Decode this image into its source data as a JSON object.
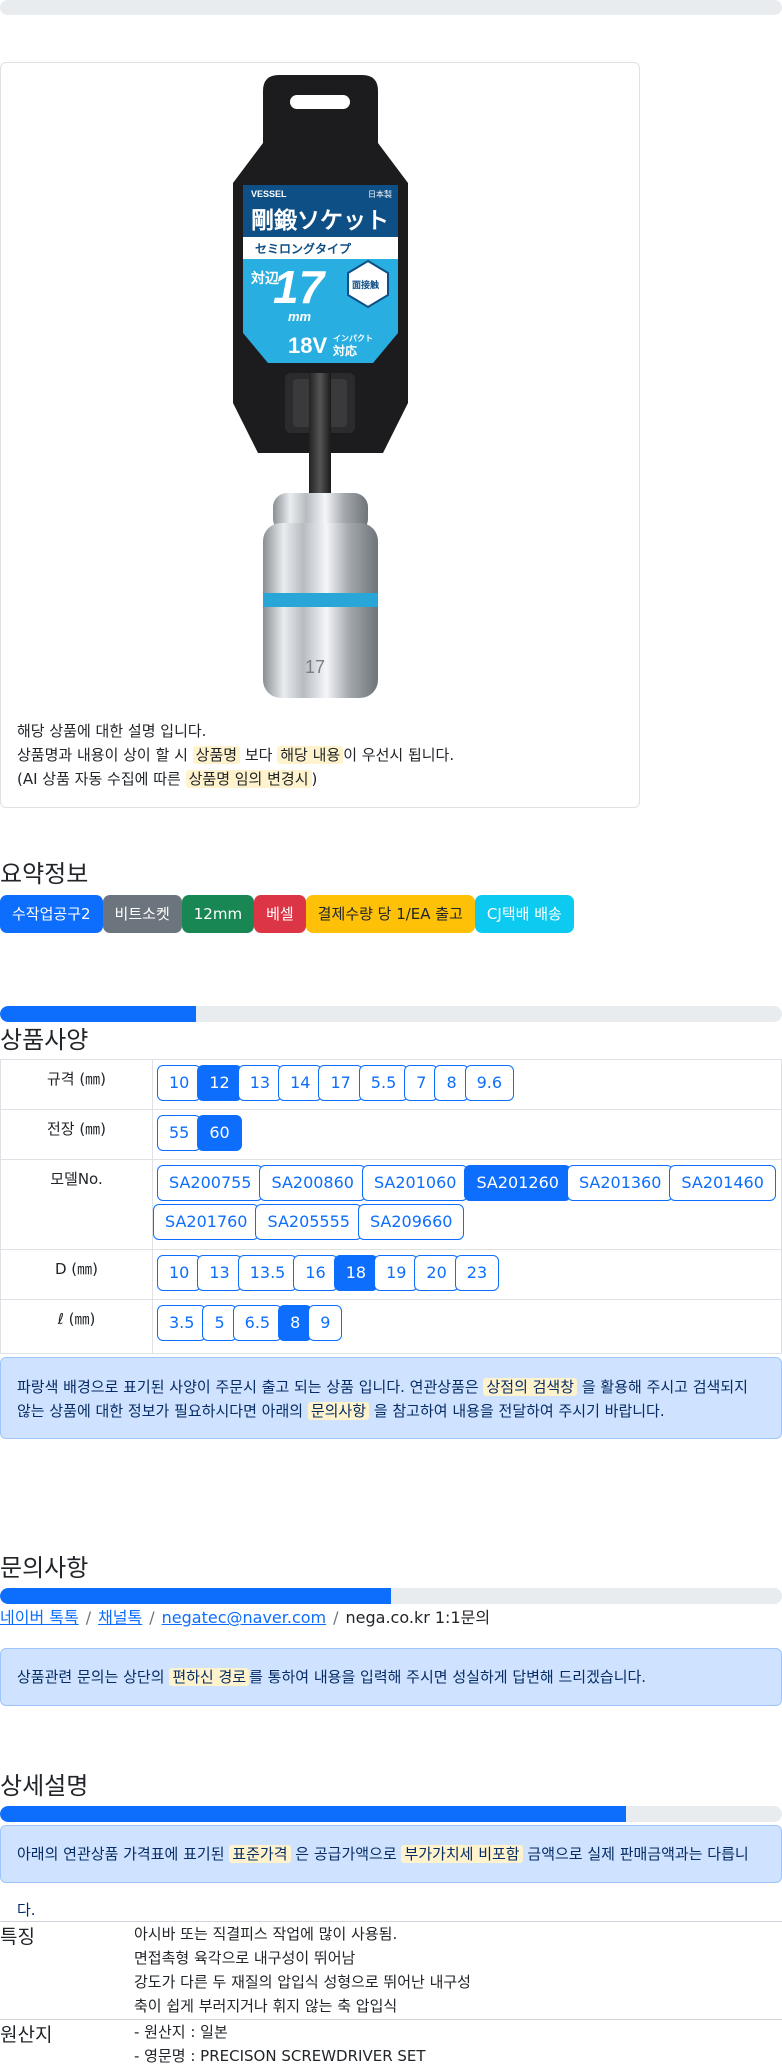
{
  "product": {
    "image": {
      "brand": "VESSEL",
      "made_in": "日本製",
      "title": "剛鍛ソケット",
      "subtitle": "セミロングタイプ",
      "taihen": "対辺",
      "size": "17",
      "unit": "mm",
      "face": "面接触",
      "impact_volt": "18V",
      "impact_top": "インパクト",
      "impact_bottom": "対応",
      "engraving": "17"
    },
    "desc_line1": "해당 상품에 대한 설명 입니다.",
    "desc_line2_a": "상품명과 내용이 상이 할 시",
    "desc_line2_hl1": "상품명",
    "desc_line2_b": "보다",
    "desc_line2_hl2": "해당 내용",
    "desc_line2_c": "이 우선시 됩니다.",
    "desc_line3_a": "(AI 상품 자동 수집에 따른",
    "desc_line3_hl": "상품명 임의 변경시",
    "desc_line3_b": ")"
  },
  "summary": {
    "title": "요약정보",
    "badges": [
      {
        "label": "수작업공구2",
        "color": "#0d6efd"
      },
      {
        "label": "비트소켓",
        "color": "#6c757d"
      },
      {
        "label": "12mm",
        "color": "#198754"
      },
      {
        "label": "베셀",
        "color": "#dc3545"
      },
      {
        "label": "결제수량 당 1/EA 출고",
        "color": "#ffc107"
      },
      {
        "label": "CJ택배 배송",
        "color": "#0dcaf0"
      }
    ]
  },
  "specs": {
    "title": "상품사양",
    "progress": 0.25,
    "rows": [
      {
        "label": "규격 (㎜)",
        "options": [
          "10",
          "12",
          "13",
          "14",
          "17",
          "5.5",
          "7",
          "8",
          "9.6"
        ],
        "selected": 1
      },
      {
        "label": "전장 (㎜)",
        "options": [
          "55",
          "60"
        ],
        "selected": 1
      },
      {
        "label": "모델No.",
        "options": [
          "SA200755",
          "SA200860",
          "SA201060",
          "SA201260",
          "SA201360",
          "SA201460",
          "SA201760",
          "SA205555",
          "SA209660"
        ],
        "selected": 3
      },
      {
        "label": "D (㎜)",
        "options": [
          "10",
          "13",
          "13.5",
          "16",
          "18",
          "19",
          "20",
          "23"
        ],
        "selected": 4
      },
      {
        "label": "ℓ (㎜)",
        "options": [
          "3.5",
          "5",
          "6.5",
          "8",
          "9"
        ],
        "selected": 3
      }
    ],
    "notice_a": "파랑색 배경으로 표기된 사양이 주문시 출고 되는 상품 입니다. 연관상품은",
    "notice_hl1": "상점의 검색창",
    "notice_b": "을 활용해 주시고 검색되지 않는 상품에 대한 정보가 필요하시다면 아래의",
    "notice_hl2": "문의사항",
    "notice_c": "을 참고하여 내용을 전달하여 주시기 바랍니다."
  },
  "inquiry": {
    "title": "문의사항",
    "progress": 0.5,
    "links": [
      "네이버 톡톡",
      "채널톡",
      "negatec@naver.com"
    ],
    "plain": "nega.co.kr 1:1문의",
    "notice_a": "상품관련 문의는 상단의",
    "notice_hl": "편하신 경로",
    "notice_b": "를 통하여 내용을 입력해 주시면 성실하게 답변해 드리겠습니다."
  },
  "details": {
    "title": "상세설명",
    "progress": 0.8,
    "notice_a": "아래의 연관상품 가격표에 표기된",
    "notice_hl1": "표준가격",
    "notice_b": "은 공급가액으로",
    "notice_hl2": "부가가치세 비포함",
    "notice_c": "금액으로 실제 판매금액과는 다릅니다.",
    "features_label": "특징",
    "features": [
      "아시바 또는 직결피스 작업에 많이 사용됨.",
      "면접촉형 육각으로 내구성이 뛰어남",
      "강도가 다른 두 재질의 압입식 성형으로 뛰어난 내구성",
      "축이 쉽게 부러지거나 휘지 않는 축 압입식"
    ],
    "origin_label": "원산지",
    "origin": [
      "- 원산지 : 일본",
      "- 영문명 : PRECISON SCREWDRIVER SET"
    ]
  }
}
